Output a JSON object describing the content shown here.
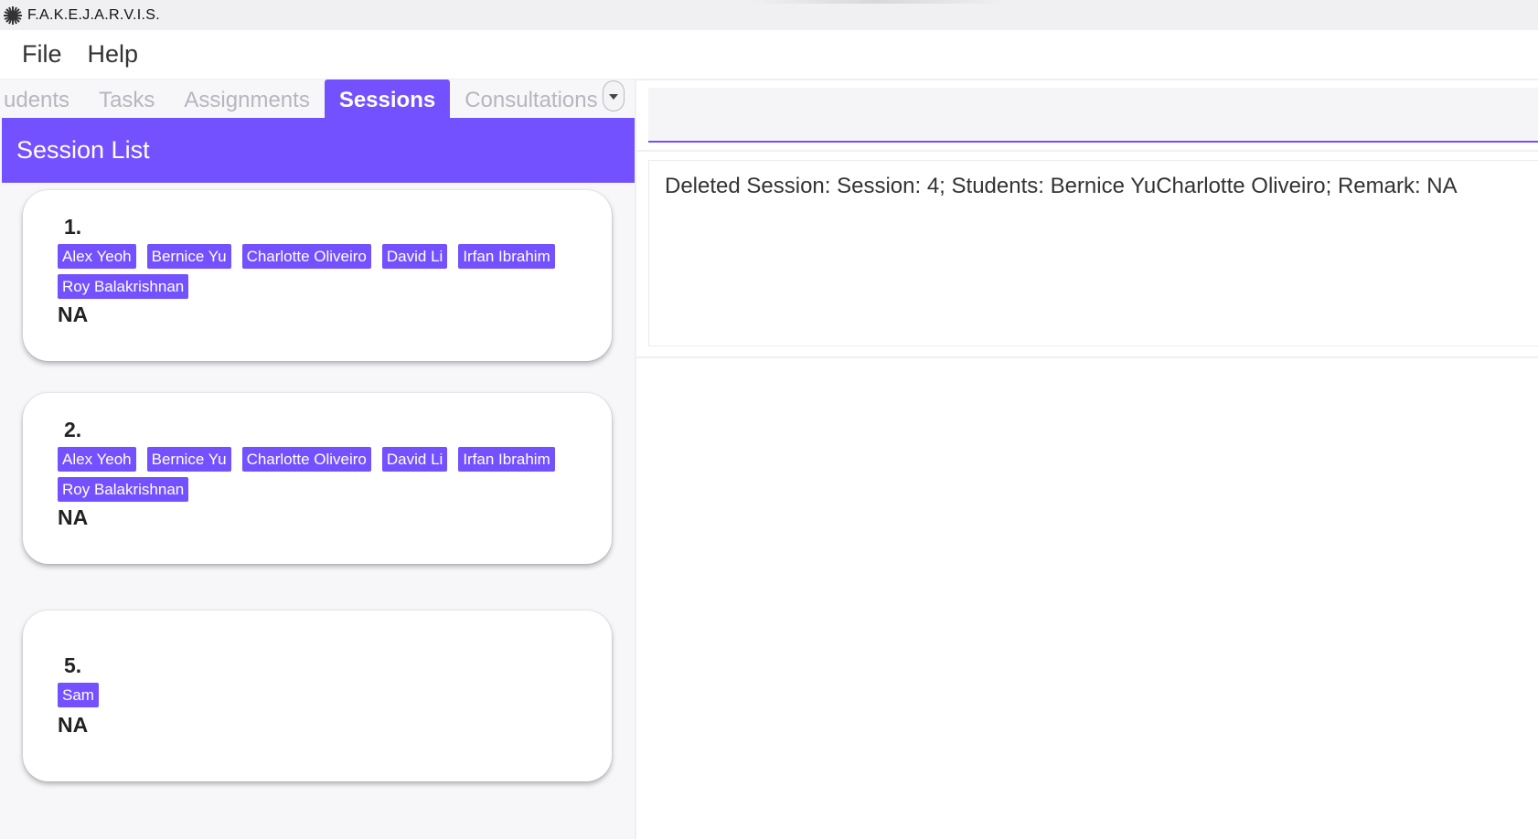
{
  "window": {
    "title": "F.A.K.E.J.A.R.V.I.S.",
    "icon": "spiky-logo-icon"
  },
  "menu": {
    "file": "File",
    "help": "Help"
  },
  "tabs": [
    {
      "label": "Students",
      "visible_label": "udents",
      "active": false
    },
    {
      "label": "Tasks",
      "active": false
    },
    {
      "label": "Assignments",
      "active": false
    },
    {
      "label": "Sessions",
      "active": true
    },
    {
      "label": "Consultations",
      "active": false
    }
  ],
  "tab_overflow_icon": "chevron-down-icon",
  "list": {
    "header": "Session List",
    "sessions": [
      {
        "index": "1.",
        "students": [
          "Alex Yeoh",
          "Bernice Yu",
          "Charlotte Oliveiro",
          "David Li",
          "Irfan Ibrahim",
          "Roy Balakrishnan"
        ],
        "remark": "NA"
      },
      {
        "index": "2.",
        "students": [
          "Alex Yeoh",
          "Bernice Yu",
          "Charlotte Oliveiro",
          "David Li",
          "Irfan Ibrahim",
          "Roy Balakrishnan"
        ],
        "remark": "NA"
      },
      {
        "index": "5.",
        "students": [
          "Sam"
        ],
        "remark": "NA"
      }
    ]
  },
  "command": {
    "value": "",
    "placeholder": ""
  },
  "result": {
    "message": "Deleted Session: Session: 4; Students: Bernice YuCharlotte Oliveiro; Remark: NA"
  },
  "colors": {
    "accent": "#7451ff",
    "tab_inactive_text": "#b6b6be",
    "pane_bg": "#f7f7fa"
  }
}
